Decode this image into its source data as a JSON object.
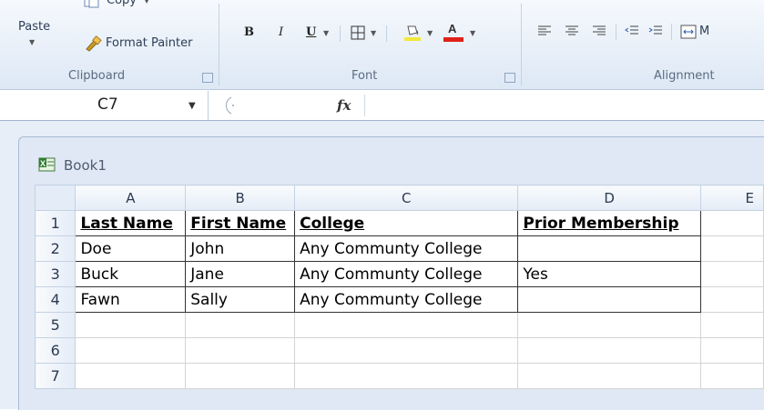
{
  "ribbon": {
    "paste_label": "Paste",
    "copy_label": "Copy",
    "format_painter_label": "Format Painter",
    "clipboard_group": "Clipboard",
    "bold": "B",
    "italic": "I",
    "underline": "U",
    "font_color_letter": "A",
    "font_group": "Font",
    "merge_label": "M",
    "alignment_group": "Alignment",
    "colors": {
      "fill": "#f3e83a",
      "font": "#e0211b"
    }
  },
  "formula_bar": {
    "name_box": "C7",
    "fx": "fx",
    "formula": ""
  },
  "workbook": {
    "title": "Book1",
    "columns": [
      "A",
      "B",
      "C",
      "D",
      "E"
    ],
    "rows": [
      {
        "num": "1",
        "cells": [
          "Last Name",
          "First Name",
          "College",
          "Prior Membership",
          ""
        ]
      },
      {
        "num": "2",
        "cells": [
          "Doe",
          "John",
          "Any Communty College",
          "",
          ""
        ]
      },
      {
        "num": "3",
        "cells": [
          "Buck",
          "Jane",
          "Any Communty College",
          "Yes",
          ""
        ]
      },
      {
        "num": "4",
        "cells": [
          "Fawn",
          "Sally",
          "Any Communty College",
          "",
          ""
        ]
      },
      {
        "num": "5",
        "cells": [
          "",
          "",
          "",
          "",
          ""
        ]
      },
      {
        "num": "6",
        "cells": [
          "",
          "",
          "",
          "",
          ""
        ]
      },
      {
        "num": "7",
        "cells": [
          "",
          "",
          "",
          "",
          ""
        ]
      }
    ]
  }
}
